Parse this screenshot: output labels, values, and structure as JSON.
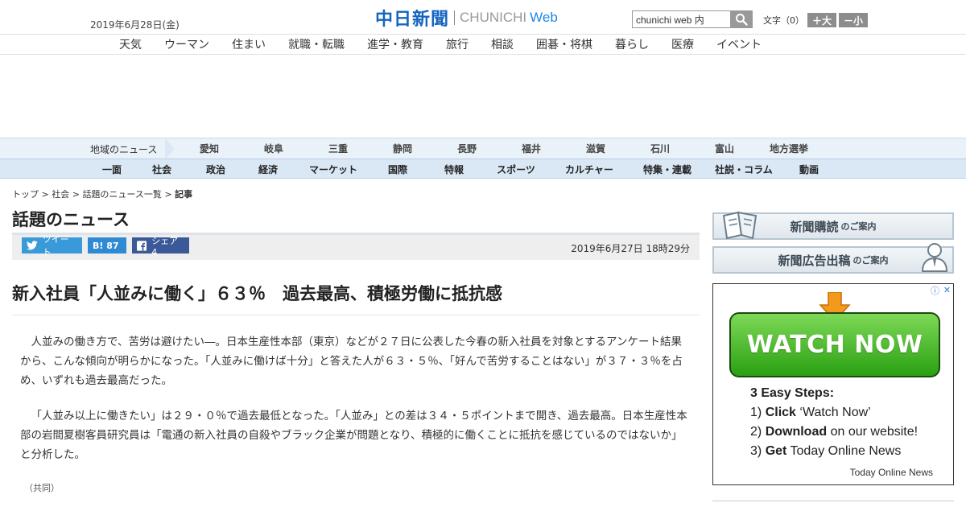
{
  "header": {
    "date": "2019年6月28日(金)",
    "logo_jp": "中日新聞",
    "logo_en": "CHUNICHI",
    "logo_web": "Web",
    "search_value": "chunichi web 内",
    "font_label": "文字（0）",
    "font_larger": "＋大",
    "font_smaller": "－小"
  },
  "category_nav": [
    "天気",
    "ウーマン",
    "住まい",
    "就職・転職",
    "進学・教育",
    "旅行",
    "相談",
    "囲碁・将棋",
    "暮らし",
    "医療",
    "イベント"
  ],
  "region_nav": {
    "label": "地域のニュース",
    "items": [
      "愛知",
      "岐阜",
      "三重",
      "静岡",
      "長野",
      "福井",
      "滋賀",
      "石川",
      "富山",
      "地方選挙"
    ]
  },
  "main_nav": [
    "一面",
    "社会",
    "政治",
    "経済",
    "マーケット",
    "国際",
    "特報",
    "スポーツ",
    "カルチャー",
    "特集・連載",
    "社説・コラム",
    "動画"
  ],
  "breadcrumb": [
    "トップ",
    "社会",
    "話題のニュース一覧",
    "記事"
  ],
  "section_title": "話題のニュース",
  "share": {
    "tweet": "ツイート",
    "hatena": "B! 87",
    "facebook": "シェア 4"
  },
  "pub_date": "2019年6月27日 18時29分",
  "article": {
    "headline": "新入社員「人並みに働く」６３％　過去最高、積極労働に抵抗感",
    "paragraphs": [
      "人並みの働き方で、苦労は避けたい―。日本生産性本部（東京）などが２７日に公表した今春の新入社員を対象とするアンケート結果から、こんな傾向が明らかになった。「人並みに働けば十分」と答えた人が６３・５％、「好んで苦労することはない」が３７・３％を占め、いずれも過去最高だった。",
      "「人並み以上に働きたい」は２９・０％で過去最低となった。「人並み」との差は３４・５ポイントまで開き、過去最高。日本生産性本部の岩間夏樹客員研究員は「電通の新入社員の自殺やブラック企業が問題となり、積極的に働くことに抵抗を感じているのではないか」と分析した。"
    ],
    "credit": "（共同）"
  },
  "sidebar": {
    "subscribe_main": "新聞購読",
    "subscribe_sub": "のご案内",
    "ads_main": "新聞広告出稿",
    "ads_sub": "のご案内"
  },
  "ad": {
    "watch_label": "WATCH NOW",
    "steps_title": "3 Easy Steps:",
    "step1_num": "1)",
    "step1_action": "Click",
    "step1_rest": "‘Watch Now’",
    "step2_num": "2)",
    "step2_action": "Download",
    "step2_rest": "on our website!",
    "step3_num": "3)",
    "step3_action": "Get",
    "step3_rest": "Today Online News",
    "brand": "Today Online News",
    "info_icon": "ⓘ",
    "close_icon": "✕"
  }
}
